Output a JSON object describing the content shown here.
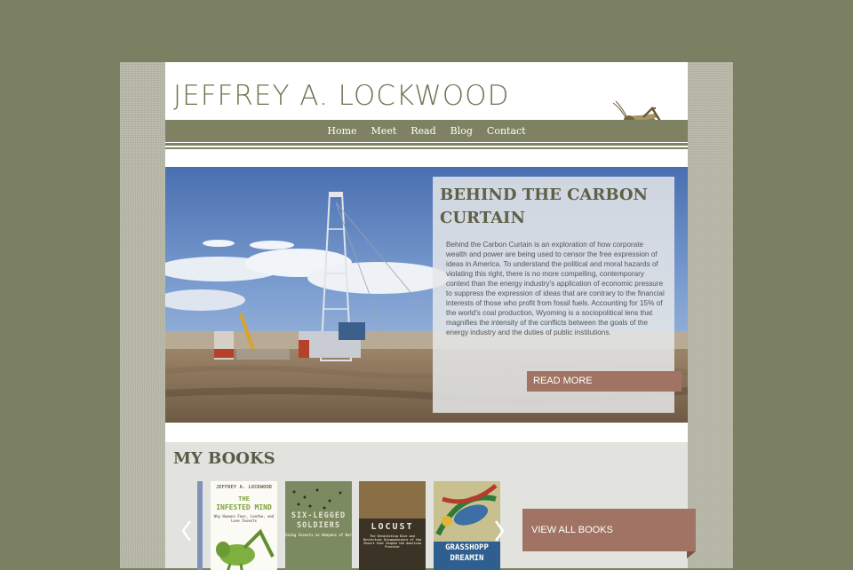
{
  "site": {
    "title": "JEFFREY A. LOCKWOOD"
  },
  "nav": {
    "items": [
      "Home",
      "Meet",
      "Read",
      "Blog",
      "Contact"
    ]
  },
  "hero": {
    "title": "BEHIND THE CARBON CURTAIN",
    "body": "Behind the Carbon Curtain is an exploration of how corporate wealth and power are being used to censor the free expression of ideas in America. To understand the political and moral hazards of violating this right, there is no more compelling, contemporary context than the energy industry's application of economic pressure to suppress the expression of ideas that are contrary to the financial interests of those who profit from fossil fuels. Accounting for 15% of the world's coal production, Wyoming is a sociopolitical lens that magnifies the intensity of the conflicts between the goals of the energy industry and the duties of public institutions.",
    "button": "READ MORE"
  },
  "books": {
    "heading": "MY BOOKS",
    "view_all": "VIEW ALL BOOKS",
    "items": [
      {
        "author": "JEFFREY A. LOCKWOOD",
        "title_lines": [
          "THE",
          "INFESTED MIND"
        ],
        "subtitle": "Why Humans Fear, Loathe, and Love Insects"
      },
      {
        "title_lines": [
          "SIX-LEGGED",
          "SOLDIERS"
        ],
        "subtitle": "Using Insects as Weapons of War"
      },
      {
        "title_lines": [
          "LOCUST"
        ],
        "subtitle": "The Devastating Rise and Mysterious Disappearance of the Insect that Shaped the American Frontier"
      },
      {
        "title_lines": [
          "GRASSHOPP",
          "DREAMIN"
        ]
      }
    ]
  },
  "icons": {
    "logo": "grasshopper-icon",
    "prev": "chevron-left-icon",
    "next": "chevron-right-icon"
  },
  "colors": {
    "background": "#7a8061",
    "nav": "#7e8262",
    "button": "#a07364",
    "title": "#6f7450"
  }
}
